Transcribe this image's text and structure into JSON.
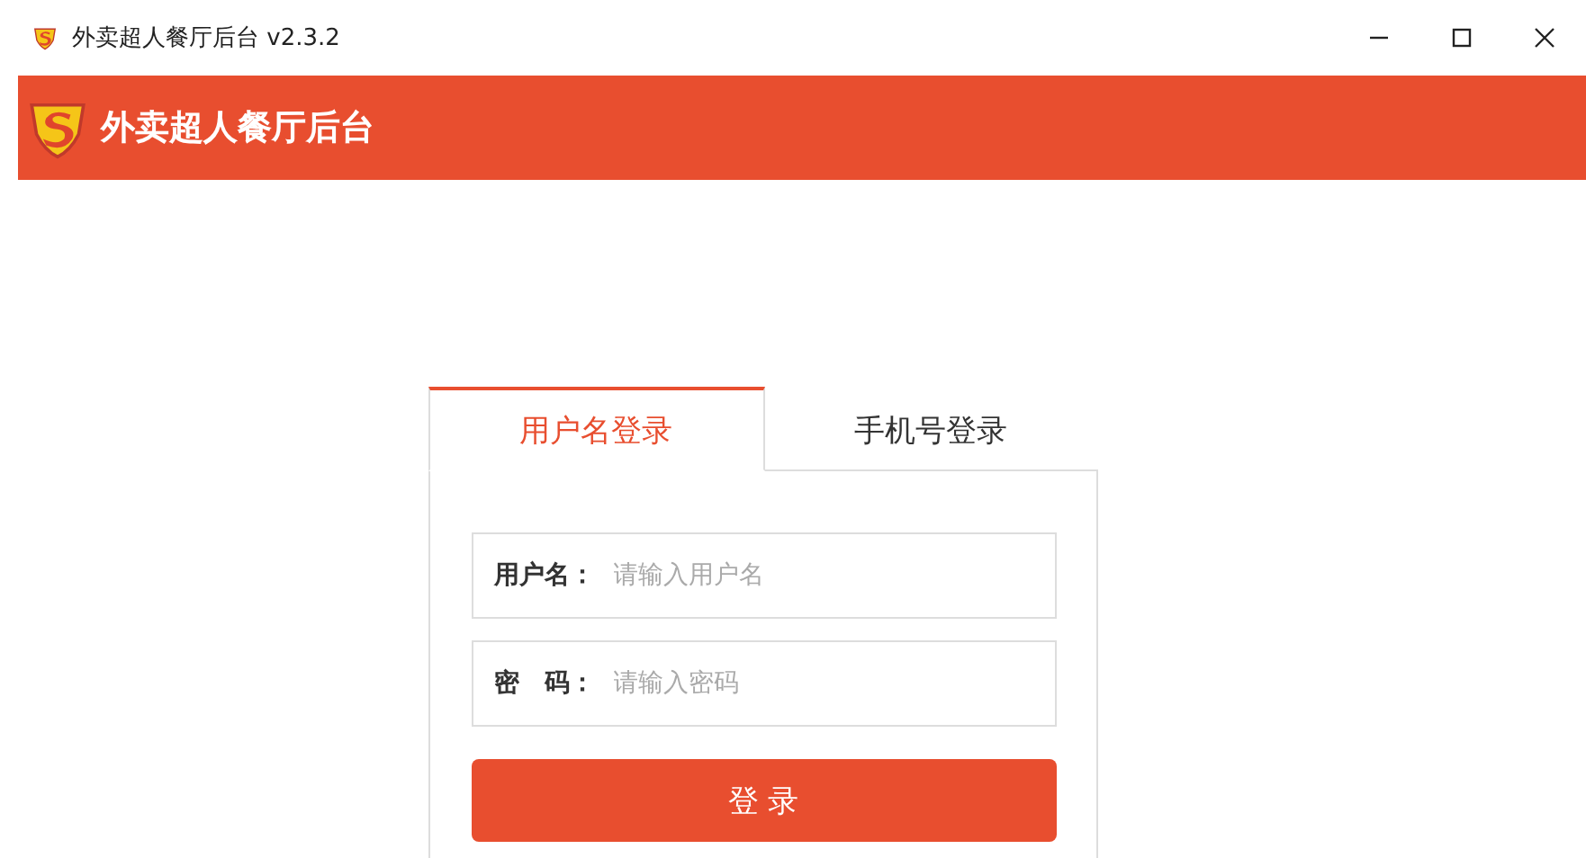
{
  "window": {
    "title": "外卖超人餐厅后台 v2.3.2"
  },
  "header": {
    "brand": "外卖超人餐厅后台"
  },
  "tabs": [
    {
      "label": "用户名登录",
      "selected": true
    },
    {
      "label": "手机号登录",
      "selected": false
    }
  ],
  "fields": [
    {
      "label": "用户名：",
      "placeholder": "请输入用户名"
    },
    {
      "label": "密　码：",
      "placeholder": "请输入密码"
    }
  ],
  "submit": {
    "label": "登 录"
  }
}
